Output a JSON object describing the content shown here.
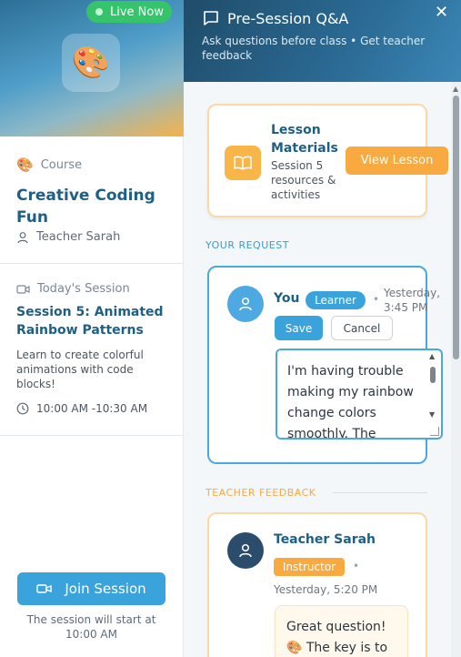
{
  "sidebar": {
    "live_label": "Live Now",
    "course_label": "Course",
    "course_title": "Creative Coding Fun",
    "teacher": "Teacher Sarah",
    "today_label": "Today's Session",
    "session_title": "Session 5: Animated Rainbow Patterns",
    "session_desc": "Learn to create colorful animations with code blocks!",
    "session_time": "10:00 AM -10:30 AM",
    "join_label": "Join Session",
    "join_note": "The session will start at 10:00 AM"
  },
  "panel": {
    "title": "Pre-Session Q&A",
    "subtitle": "Ask questions before class • Get teacher feedback",
    "materials": {
      "title": "Lesson Materials",
      "subtitle": "Session 5 resources & activities",
      "button": "View Lesson"
    },
    "request": {
      "section_label": "YOUR REQUEST",
      "author": "You",
      "badge": "Learner",
      "time": "Yesterday, 3:45 PM",
      "save_label": "Save",
      "cancel_label": "Cancel",
      "text": "I'm having trouble making my rainbow change colors smoothly. The"
    },
    "feedback": {
      "section_label": "TEACHER FEEDBACK",
      "author": "Teacher Sarah",
      "badge": "Instructor",
      "time": "Yesterday, 5:20 PM",
      "text": "Great question! 🎨 The key is to"
    }
  },
  "colors": {
    "primary": "#3ba3dc",
    "accent": "#f8a940",
    "live": "#35c46c",
    "title": "#1f5f85"
  },
  "icons": {
    "course": "palette-icon",
    "teacher": "user-icon",
    "session": "video-icon",
    "time": "clock-icon",
    "chat": "chat-icon",
    "materials": "book-icon"
  }
}
